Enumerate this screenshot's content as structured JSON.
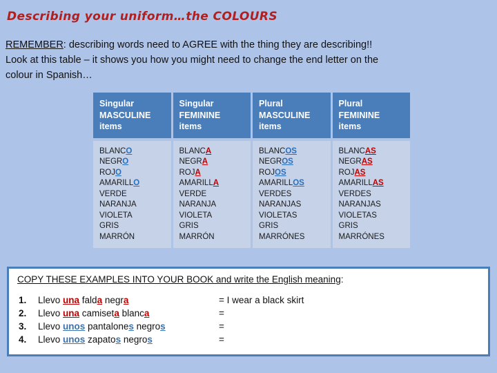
{
  "slide": {
    "title": "Describing your uniform…the COLOURS",
    "background_color": "#aec3e8",
    "accent_blue": "#4a7ebb",
    "title_red": "#b02020",
    "highlight_blue": "#2a6fbb",
    "highlight_red": "#c00000"
  },
  "intro": {
    "remember_label": "REMEMBER",
    "remember_rest": ": describing words need to AGREE with the thing they are describing!!",
    "line2": "Look at this table – it shows you how you might need to change the end letter on the",
    "line3": "colour in Spanish…"
  },
  "table": {
    "headers": [
      {
        "line1": "Singular",
        "line2": "MASCULINE",
        "line3": "items"
      },
      {
        "line1": "Singular",
        "line2": "FEMININE",
        "line3": "items"
      },
      {
        "line1": "Plural",
        "line2": "MASCULINE",
        "line3": "items"
      },
      {
        "line1": "Plural",
        "line2": "FEMININE",
        "line3": "items"
      }
    ],
    "columns": [
      {
        "ending_color": "blue",
        "words": [
          {
            "stem": "BLANC",
            "ending": "O"
          },
          {
            "stem": "NEGR",
            "ending": "O"
          },
          {
            "stem": "ROJ",
            "ending": "O"
          },
          {
            "stem": "AMARILL",
            "ending": "O"
          },
          {
            "stem": "VERDE",
            "ending": ""
          },
          {
            "stem": "NARANJA",
            "ending": ""
          },
          {
            "stem": "VIOLETA",
            "ending": ""
          },
          {
            "stem": "GRIS",
            "ending": ""
          },
          {
            "stem": "MARRÓN",
            "ending": ""
          }
        ]
      },
      {
        "ending_color": "red",
        "words": [
          {
            "stem": "BLANC",
            "ending": "A"
          },
          {
            "stem": "NEGR",
            "ending": "A"
          },
          {
            "stem": "ROJ",
            "ending": "A"
          },
          {
            "stem": "AMARILL",
            "ending": "A"
          },
          {
            "stem": "VERDE",
            "ending": ""
          },
          {
            "stem": "NARANJA",
            "ending": ""
          },
          {
            "stem": "VIOLETA",
            "ending": ""
          },
          {
            "stem": "GRIS",
            "ending": ""
          },
          {
            "stem": "MARRÓN",
            "ending": ""
          }
        ]
      },
      {
        "ending_color": "blue",
        "words": [
          {
            "stem": "BLANC",
            "ending": "OS"
          },
          {
            "stem": "NEGR",
            "ending": "OS"
          },
          {
            "stem": "ROJ",
            "ending": "OS"
          },
          {
            "stem": "AMARILL",
            "ending": "OS"
          },
          {
            "stem": "VERDES",
            "ending": ""
          },
          {
            "stem": "NARANJAS",
            "ending": ""
          },
          {
            "stem": "VIOLETAS",
            "ending": ""
          },
          {
            "stem": "GRIS",
            "ending": ""
          },
          {
            "stem": "MARRÓNES",
            "ending": ""
          }
        ]
      },
      {
        "ending_color": "red",
        "words": [
          {
            "stem": "BLANC",
            "ending": "AS"
          },
          {
            "stem": "NEGR",
            "ending": "AS"
          },
          {
            "stem": "ROJ",
            "ending": "AS"
          },
          {
            "stem": "AMARILL",
            "ending": "AS"
          },
          {
            "stem": "VERDES",
            "ending": ""
          },
          {
            "stem": "NARANJAS",
            "ending": ""
          },
          {
            "stem": "VIOLETAS",
            "ending": ""
          },
          {
            "stem": "GRIS",
            "ending": ""
          },
          {
            "stem": "MARRÓNES",
            "ending": ""
          }
        ]
      }
    ]
  },
  "exercise": {
    "heading_underlined": "COPY THESE EXAMPLES INTO YOUR BOOK and write the English meaning",
    "heading_tail": ":",
    "items": [
      {
        "number": "1.",
        "parts": [
          {
            "t": "Llevo ",
            "c": "plain"
          },
          {
            "t": "una",
            "c": "red"
          },
          {
            "t": " fald",
            "c": "plain"
          },
          {
            "t": "a",
            "c": "red"
          },
          {
            "t": " negr",
            "c": "plain"
          },
          {
            "t": "a",
            "c": "red"
          }
        ],
        "english": "= I wear a black skirt"
      },
      {
        "number": "2.",
        "parts": [
          {
            "t": "Llevo ",
            "c": "plain"
          },
          {
            "t": "una",
            "c": "red"
          },
          {
            "t": " camiset",
            "c": "plain"
          },
          {
            "t": "a",
            "c": "red"
          },
          {
            "t": " blanc",
            "c": "plain"
          },
          {
            "t": "a",
            "c": "red"
          }
        ],
        "english": "="
      },
      {
        "number": "3.",
        "parts": [
          {
            "t": "Llevo ",
            "c": "plain"
          },
          {
            "t": "unos",
            "c": "blue"
          },
          {
            "t": " pantalone",
            "c": "plain"
          },
          {
            "t": "s",
            "c": "blue"
          },
          {
            "t": " negro",
            "c": "plain"
          },
          {
            "t": "s",
            "c": "blue"
          }
        ],
        "english": "="
      },
      {
        "number": "4.",
        "parts": [
          {
            "t": "Llevo ",
            "c": "plain"
          },
          {
            "t": "unos",
            "c": "blue"
          },
          {
            "t": " zapato",
            "c": "plain"
          },
          {
            "t": "s",
            "c": "blue"
          },
          {
            "t": " negro",
            "c": "plain"
          },
          {
            "t": "s",
            "c": "blue"
          }
        ],
        "english": "="
      }
    ]
  }
}
